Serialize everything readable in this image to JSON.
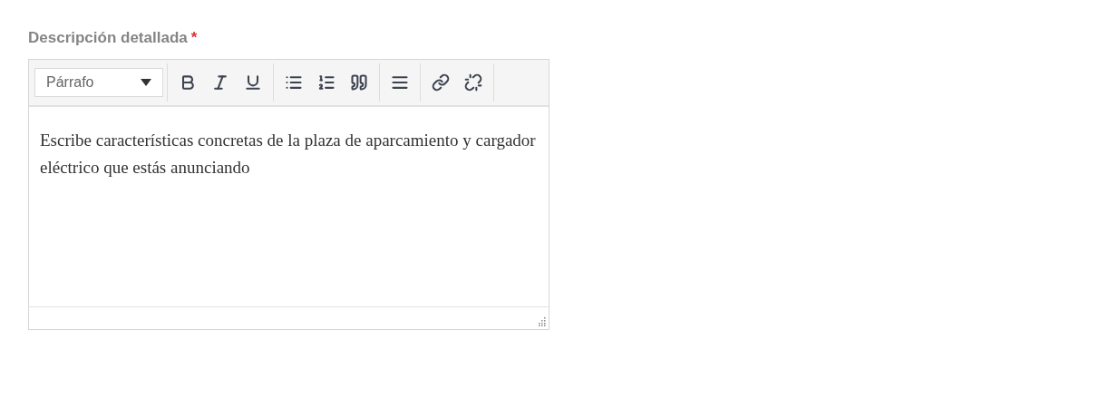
{
  "field": {
    "label": "Descripción detallada",
    "required_mark": "*"
  },
  "editor": {
    "format_select": {
      "value": "Párrafo"
    },
    "content": "Escribe características concretas de la plaza de aparcamiento y cargador eléctrico que estás anunciando"
  }
}
